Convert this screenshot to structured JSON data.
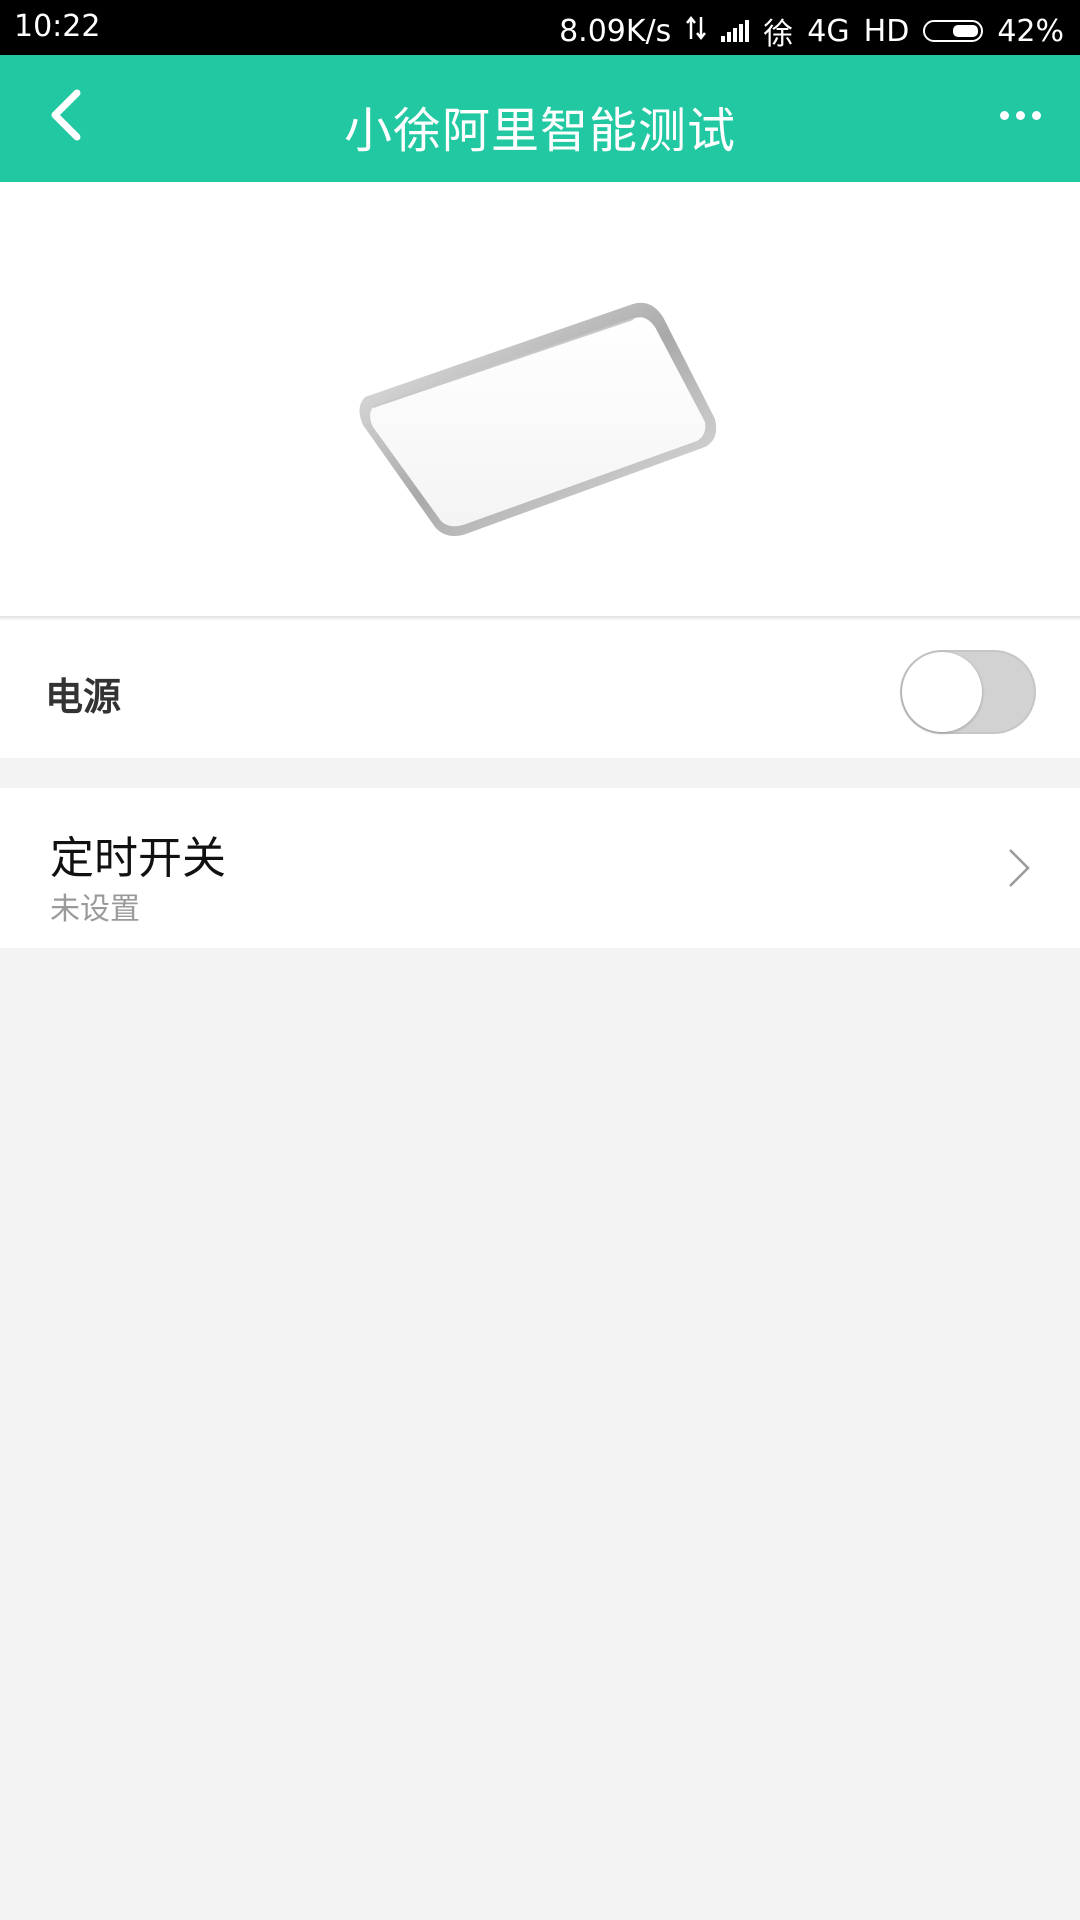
{
  "status_bar": {
    "time": "10:22",
    "net_speed": "8.09K/s",
    "carrier": "徐",
    "network": "4G",
    "hd": "HD",
    "battery": "42%"
  },
  "header": {
    "title": "小徐阿里智能测试",
    "background": "#21c8a1"
  },
  "power": {
    "label": "电源",
    "on": false
  },
  "timer": {
    "title": "定时开关",
    "subtitle": "未设置"
  }
}
